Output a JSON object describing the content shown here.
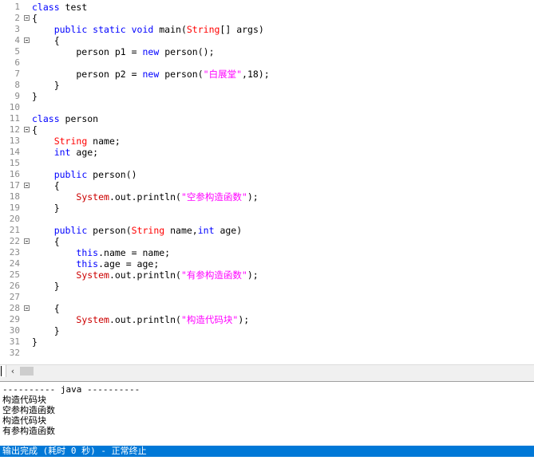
{
  "colors": {
    "default": "#000000",
    "keyword": "#0000ff",
    "type": "#ff0000",
    "system": "#cc0000",
    "string": "#ff00ff",
    "linenum": "#8a8a8a",
    "status_bg": "#0078d7"
  },
  "code_lines": [
    {
      "n": "1",
      "fold": false,
      "tokens": [
        {
          "t": "k",
          "v": "class"
        },
        {
          "t": "d",
          "v": " test"
        }
      ]
    },
    {
      "n": "2",
      "fold": true,
      "tokens": [
        {
          "t": "d",
          "v": "{"
        }
      ]
    },
    {
      "n": "3",
      "fold": false,
      "tokens": [
        {
          "t": "d",
          "v": "    "
        },
        {
          "t": "k",
          "v": "public static void"
        },
        {
          "t": "d",
          "v": " main("
        },
        {
          "t": "ty",
          "v": "String"
        },
        {
          "t": "d",
          "v": "[] args)"
        }
      ]
    },
    {
      "n": "4",
      "fold": true,
      "tokens": [
        {
          "t": "d",
          "v": "    {"
        }
      ]
    },
    {
      "n": "5",
      "fold": false,
      "tokens": [
        {
          "t": "d",
          "v": "        person p1 = "
        },
        {
          "t": "k",
          "v": "new"
        },
        {
          "t": "d",
          "v": " person();"
        }
      ]
    },
    {
      "n": "6",
      "fold": false,
      "tokens": []
    },
    {
      "n": "7",
      "fold": false,
      "tokens": [
        {
          "t": "d",
          "v": "        person p2 = "
        },
        {
          "t": "k",
          "v": "new"
        },
        {
          "t": "d",
          "v": " person("
        },
        {
          "t": "s",
          "v": "\"白展堂\""
        },
        {
          "t": "d",
          "v": ",18);"
        }
      ]
    },
    {
      "n": "8",
      "fold": false,
      "tokens": [
        {
          "t": "d",
          "v": "    }"
        }
      ]
    },
    {
      "n": "9",
      "fold": false,
      "tokens": [
        {
          "t": "d",
          "v": "}"
        }
      ]
    },
    {
      "n": "10",
      "fold": false,
      "tokens": []
    },
    {
      "n": "11",
      "fold": false,
      "tokens": [
        {
          "t": "k",
          "v": "class"
        },
        {
          "t": "d",
          "v": " person"
        }
      ]
    },
    {
      "n": "12",
      "fold": true,
      "tokens": [
        {
          "t": "d",
          "v": "{"
        }
      ]
    },
    {
      "n": "13",
      "fold": false,
      "tokens": [
        {
          "t": "d",
          "v": "    "
        },
        {
          "t": "ty",
          "v": "String"
        },
        {
          "t": "d",
          "v": " name;"
        }
      ]
    },
    {
      "n": "14",
      "fold": false,
      "tokens": [
        {
          "t": "d",
          "v": "    "
        },
        {
          "t": "k",
          "v": "int"
        },
        {
          "t": "d",
          "v": " age;"
        }
      ]
    },
    {
      "n": "15",
      "fold": false,
      "tokens": []
    },
    {
      "n": "16",
      "fold": false,
      "tokens": [
        {
          "t": "d",
          "v": "    "
        },
        {
          "t": "k",
          "v": "public"
        },
        {
          "t": "d",
          "v": " person()"
        }
      ]
    },
    {
      "n": "17",
      "fold": true,
      "tokens": [
        {
          "t": "d",
          "v": "    {"
        }
      ]
    },
    {
      "n": "18",
      "fold": false,
      "tokens": [
        {
          "t": "d",
          "v": "        "
        },
        {
          "t": "sys",
          "v": "System"
        },
        {
          "t": "d",
          "v": ".out.println("
        },
        {
          "t": "s",
          "v": "\"空参构造函数\""
        },
        {
          "t": "d",
          "v": ");"
        }
      ]
    },
    {
      "n": "19",
      "fold": false,
      "tokens": [
        {
          "t": "d",
          "v": "    }"
        }
      ]
    },
    {
      "n": "20",
      "fold": false,
      "tokens": []
    },
    {
      "n": "21",
      "fold": false,
      "tokens": [
        {
          "t": "d",
          "v": "    "
        },
        {
          "t": "k",
          "v": "public"
        },
        {
          "t": "d",
          "v": " person("
        },
        {
          "t": "ty",
          "v": "String"
        },
        {
          "t": "d",
          "v": " name,"
        },
        {
          "t": "k",
          "v": "int"
        },
        {
          "t": "d",
          "v": " age)"
        }
      ]
    },
    {
      "n": "22",
      "fold": true,
      "tokens": [
        {
          "t": "d",
          "v": "    {"
        }
      ]
    },
    {
      "n": "23",
      "fold": false,
      "tokens": [
        {
          "t": "d",
          "v": "        "
        },
        {
          "t": "k",
          "v": "this"
        },
        {
          "t": "d",
          "v": ".name = name;"
        }
      ]
    },
    {
      "n": "24",
      "fold": false,
      "tokens": [
        {
          "t": "d",
          "v": "        "
        },
        {
          "t": "k",
          "v": "this"
        },
        {
          "t": "d",
          "v": ".age = age;"
        }
      ]
    },
    {
      "n": "25",
      "fold": false,
      "tokens": [
        {
          "t": "d",
          "v": "        "
        },
        {
          "t": "sys",
          "v": "System"
        },
        {
          "t": "d",
          "v": ".out.println("
        },
        {
          "t": "s",
          "v": "\"有参构造函数\""
        },
        {
          "t": "d",
          "v": ");"
        }
      ]
    },
    {
      "n": "26",
      "fold": false,
      "tokens": [
        {
          "t": "d",
          "v": "    }"
        }
      ]
    },
    {
      "n": "27",
      "fold": false,
      "tokens": []
    },
    {
      "n": "28",
      "fold": true,
      "tokens": [
        {
          "t": "d",
          "v": "    {"
        }
      ]
    },
    {
      "n": "29",
      "fold": false,
      "tokens": [
        {
          "t": "d",
          "v": "        "
        },
        {
          "t": "sys",
          "v": "System"
        },
        {
          "t": "d",
          "v": ".out.println("
        },
        {
          "t": "s",
          "v": "\"构造代码块\""
        },
        {
          "t": "d",
          "v": ");"
        }
      ]
    },
    {
      "n": "30",
      "fold": false,
      "tokens": [
        {
          "t": "d",
          "v": "    }"
        }
      ]
    },
    {
      "n": "31",
      "fold": false,
      "tokens": [
        {
          "t": "d",
          "v": "}"
        }
      ]
    },
    {
      "n": "32",
      "fold": false,
      "tokens": []
    }
  ],
  "scrollbar": {
    "left_arrow_icon": "‹"
  },
  "output": {
    "lines": [
      "---------- java ----------",
      "构造代码块",
      "空参构造函数",
      "构造代码块",
      "有参构造函数"
    ]
  },
  "status": {
    "text": "输出完成 (耗时 0 秒) - 正常终止"
  }
}
